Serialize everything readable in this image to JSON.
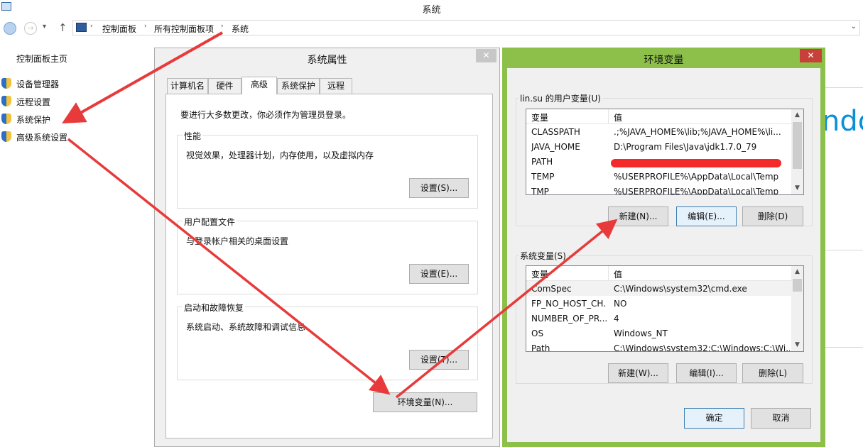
{
  "window": {
    "title": "系统"
  },
  "address_bar": {
    "crumbs": [
      "控制面板",
      "所有控制面板项",
      "系统"
    ]
  },
  "sidebar": {
    "home": "控制面板主页",
    "items": [
      {
        "label": "设备管理器",
        "icon": "shield-icon"
      },
      {
        "label": "远程设置",
        "icon": "shield-icon"
      },
      {
        "label": "系统保护",
        "icon": "shield-icon"
      },
      {
        "label": "高级系统设置",
        "icon": "shield-icon"
      }
    ]
  },
  "background": {
    "partial_text": "ndo"
  },
  "system_properties": {
    "title": "系统属性",
    "close": "✕",
    "tabs": [
      "计算机名",
      "硬件",
      "高级",
      "系统保护",
      "远程"
    ],
    "active_tab": "高级",
    "notice": "要进行大多数更改，你必须作为管理员登录。",
    "groups": [
      {
        "title": "性能",
        "desc": "视觉效果，处理器计划，内存使用，以及虚拟内存",
        "button": "设置(S)..."
      },
      {
        "title": "用户配置文件",
        "desc": "与登录帐户相关的桌面设置",
        "button": "设置(E)..."
      },
      {
        "title": "启动和故障恢复",
        "desc": "系统启动、系统故障和调试信息",
        "button": "设置(T)..."
      }
    ],
    "env_button": "环境变量(N)..."
  },
  "environment_variables": {
    "title": "环境变量",
    "close": "✕",
    "user_section": {
      "title": "lin.su 的用户变量(U)",
      "columns": [
        "变量",
        "值"
      ],
      "rows": [
        {
          "name": "CLASSPATH",
          "value": ".;%JAVA_HOME%\\lib;%JAVA_HOME%\\li..."
        },
        {
          "name": "JAVA_HOME",
          "value": "D:\\Program Files\\Java\\jdk1.7.0_79"
        },
        {
          "name": "PATH",
          "value": ""
        },
        {
          "name": "TEMP",
          "value": "%USERPROFILE%\\AppData\\Local\\Temp"
        },
        {
          "name": "TMP",
          "value": "%USERPROFILE%\\AppData\\Local\\Temp"
        }
      ],
      "buttons": {
        "new": "新建(N)...",
        "edit": "编辑(E)...",
        "delete": "删除(D)"
      }
    },
    "system_section": {
      "title": "系统变量(S)",
      "columns": [
        "变量",
        "值"
      ],
      "rows": [
        {
          "name": "ComSpec",
          "value": "C:\\Windows\\system32\\cmd.exe"
        },
        {
          "name": "FP_NO_HOST_CH...",
          "value": "NO"
        },
        {
          "name": "NUMBER_OF_PR...",
          "value": "4"
        },
        {
          "name": "OS",
          "value": "Windows_NT"
        },
        {
          "name": "Path",
          "value": "C:\\Windows\\system32;C:\\Windows;C:\\Wi..."
        }
      ],
      "buttons": {
        "new": "新建(W)...",
        "edit": "编辑(I)...",
        "delete": "删除(L)"
      }
    },
    "ok": "确定",
    "cancel": "取消"
  },
  "colors": {
    "annotation_arrow": "#e83a3a",
    "env_dialog_frame": "#8dc04a",
    "close_button_red": "#c7413a"
  }
}
